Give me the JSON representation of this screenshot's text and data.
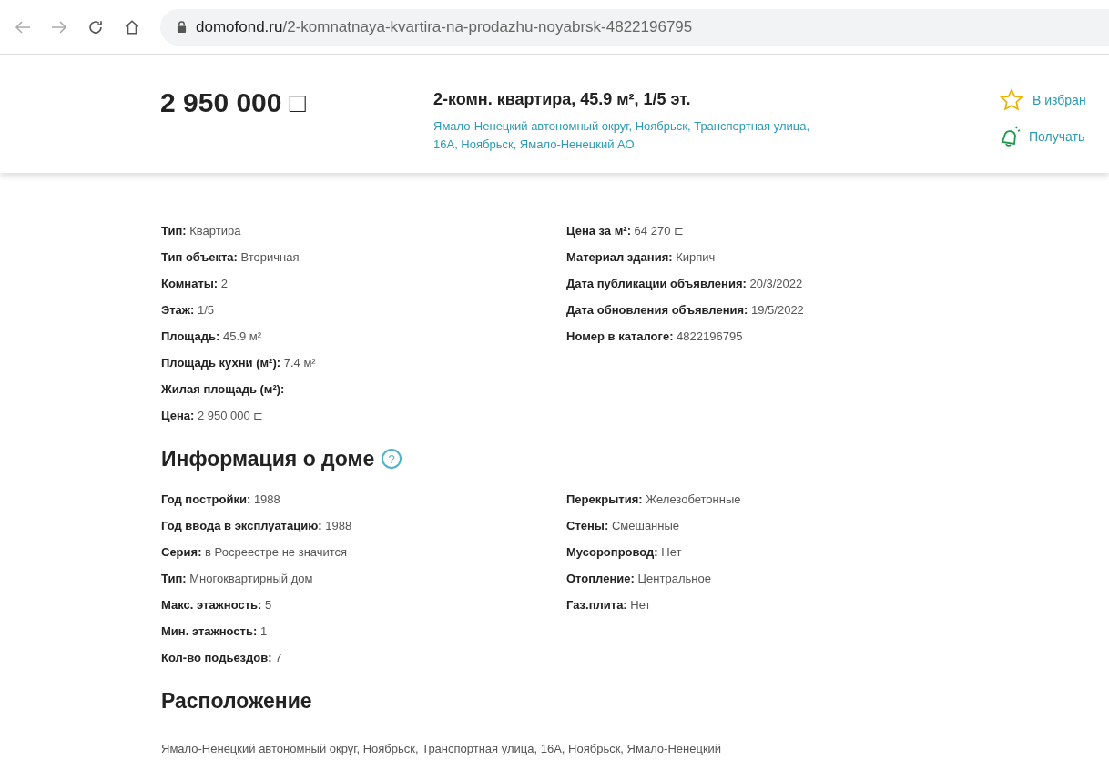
{
  "browser": {
    "url_domain": "domofond.ru",
    "url_path": "/2-komnatnaya-kvartira-na-prodazhu-noyabrsk-4822196795"
  },
  "header": {
    "price": "2 950 000 □",
    "title": "2-комн. квартира, 45.9 м², 1/5 эт.",
    "address": "Ямало-Ненецкий автономный округ, Ноябрьск, Транспортная улица, 16А, Ноябрьск, Ямало-Ненецкий АО",
    "actions": [
      {
        "kind": "favorite",
        "label": "В избран"
      },
      {
        "kind": "notify",
        "label": "Получать"
      }
    ]
  },
  "offer": {
    "left": [
      "**Тип:** Квартира",
      "**Тип объекта:** Вторичная",
      "**Комнаты:** 2",
      "**Этаж:** 1/5",
      "**Площадь:** 45.9 м²",
      "**Площадь кухни (м²):** 7.4 м²",
      "**Жилая площадь (м²):**",
      "**Цена:** 2 950 000 ⊏"
    ],
    "right": [
      "**Цена за м²:** 64 270 ⊏",
      "**Материал здания:** Кирпич",
      "**Дата публикации объявления:** 20/3/2022",
      "**Дата обновления объявления:** 19/5/2022",
      "**Номер в каталоге:** 4822196795"
    ]
  },
  "house": {
    "title": "Информация о доме",
    "help_icon": "?",
    "left": [
      "**Год постройки:** 1988",
      "**Год ввода в эксплуатацию:** 1988",
      "**Серия:** в Росреестре не значится",
      "**Тип:** Многоквартирный дом",
      "**Макс. этажность:** 5",
      "**Мин. этажность:** 1",
      "**Кол-во подьездов:** 7"
    ],
    "right": [
      "**Перекрытия:** Железобетонные",
      "**Стены:** Смешанные",
      "**Мусоропровод:** Нет",
      "**Отопление:** Центральное",
      "**Газ.плита:** Нет"
    ]
  },
  "location": {
    "title": "Расположение",
    "address": "Ямало-Ненецкий автономный округ, Ноябрьск, Транспортная улица, 16А, Ноябрьск, Ямало-Ненецкий"
  }
}
